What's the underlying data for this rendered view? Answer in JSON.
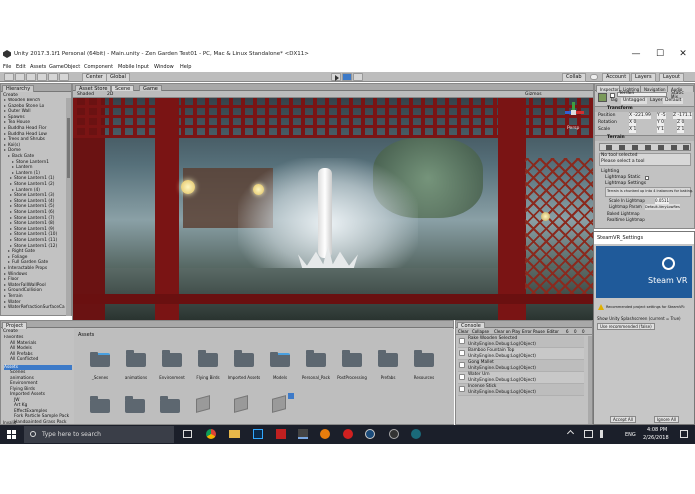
{
  "titlebar": {
    "title": "Unity 2017.3.1f1 Personal (64bit) - Main.unity - Zen Garden Test01 - PC, Mac & Linux Standalone* <DX11>",
    "minimize": "—",
    "maximize": "☐",
    "close": "✕"
  },
  "menubar": {
    "items": [
      "File",
      "Edit",
      "Assets",
      "GameObject",
      "Component",
      "Mobile Input",
      "Window",
      "Help"
    ]
  },
  "toolbar": {
    "center_mode": "Center",
    "global_mode": "Global",
    "collab": "Collab",
    "account": "Account",
    "layers": "Layers",
    "layout": "Layout"
  },
  "hierarchy": {
    "tab": "Hierarchy",
    "create": "Create",
    "items": [
      "Wooden Bench",
      "Gazebo Stone Lo",
      "Outer Wall",
      "Spawns",
      "Tea House",
      "Buddha Head Flor",
      "Buddha Head Low",
      "Trees and Shrubs",
      "Koi(s)",
      "Dome",
      "Back Gate",
      "Stone Lantern1",
      "Lantern",
      "Lantern (1)",
      "Stone Lantern1 (1)",
      "Stone Lantern1 (2)",
      "Lantern (4)",
      "Stone Lantern1 (3)",
      "Stone Lantern1 (4)",
      "Stone Lantern1 (5)",
      "Stone Lantern1 (6)",
      "Stone Lantern1 (7)",
      "Stone Lantern1 (8)",
      "Stone Lantern1 (9)",
      "Stone Lantern1 (10)",
      "Stone Lantern1 (11)",
      "Stone Lantern1 (12)",
      "Right Gate",
      "Foliage",
      "Full Garden Gate",
      "Interactable Props",
      "Windows",
      "Floor",
      "WaterFallWallPool",
      "GroundCollision",
      "Terrain",
      "Water",
      "WaterRefractionSurfaceCam"
    ]
  },
  "scene": {
    "tabs": [
      "Asset Store",
      "Scene",
      "Game"
    ],
    "shaded": "Shaded",
    "mode2d": "2D",
    "gizmos": "Gizmos",
    "persp": "Persp"
  },
  "project": {
    "tab": "Project",
    "create": "Create",
    "favorites": [
      "Favorites",
      "All Materials",
      "All Models",
      "All Prefabs",
      "All Conflicted"
    ],
    "tree": [
      "Assets",
      "Scenes",
      "animations",
      "Environment",
      "Flying Birds",
      "Imported Assets",
      "JW",
      "Art Kg",
      "EffectExamples",
      "Fork Particle Sample Pack",
      "Handpainted Grass Pack"
    ],
    "breadcrumb": "Assets",
    "assets_row1": [
      "_Scenes",
      "animations",
      "Environment",
      "Flying Birds",
      "Imported Assets",
      "Models",
      "Personal_Pack",
      "PostProcessing",
      "Prefabs",
      "Resources"
    ],
    "status": "Invalid",
    "file_label": "Jam.unity"
  },
  "console": {
    "tab": "Console",
    "buttons": [
      "Clear",
      "Collapse",
      "Clear on Play",
      "Error Pause",
      "Editor"
    ],
    "counts": [
      "6",
      "0",
      "0"
    ],
    "rows": [
      {
        "title": "Rake Wooden Selected",
        "sub": "UnityEngine.Debug:Log(Object)"
      },
      {
        "title": "Bamboo Fountain Top",
        "sub": "UnityEngine.Debug:Log(Object)"
      },
      {
        "title": "Gong Mallet",
        "sub": "UnityEngine.Debug:Log(Object)"
      },
      {
        "title": "Water Urn",
        "sub": "UnityEngine.Debug:Log(Object)"
      },
      {
        "title": "Incense Stick",
        "sub": "UnityEngine.Debug:Log(Object)"
      }
    ]
  },
  "inspector": {
    "tabs": [
      "Inspector",
      "Lighting",
      "Navigation",
      "Audio Mix"
    ],
    "object_name": "Terrain",
    "static": "Static",
    "tag_label": "Tag",
    "tag_value": "Untagged",
    "layer_label": "Layer",
    "layer_value": "Default",
    "transform": "Transform",
    "position": "Position",
    "rotation": "Rotation",
    "scale": "Scale",
    "pos_x": "X -221.99",
    "pos_y": "Y -5",
    "pos_z": "Z -171.1",
    "rot_x": "X 0",
    "rot_y": "Y 0",
    "rot_z": "Z 0",
    "scl_x": "X 1",
    "scl_y": "Y 1",
    "scl_z": "Z 1",
    "terrain": "Terrain",
    "no_tool": "No tool selected",
    "please_select": "Please select a tool",
    "lighting": "Lighting",
    "lightmap_static": "Lightmap Static",
    "lightmap_settings": "Lightmap Settings",
    "lightmap_note": "Terrain is chunked up into 4 instances for baking.",
    "scale_in_lightmap": "Scale In Lightmap",
    "scale_value": "0.0511",
    "lightmap_param": "Lightmap Param",
    "param_value": "Default-VeryLowRes",
    "baked_lightmap": "Baked Lightmap",
    "realtime_lightmap": "Realtime Lightmap"
  },
  "steamvr_popup": {
    "title": "SteamVR_Settings",
    "logo_text": "Steam VR",
    "recommended": "Recommended project settings for SteamVR:",
    "row1": "Show Unity Splashscreen (current = True)",
    "use_recommended": "Use recommended (false)",
    "accept_all": "Accept All",
    "ignore_all": "Ignore All"
  },
  "taskbar": {
    "search_placeholder": "Type here to search",
    "time": "4:08 PM",
    "date": "2/26/2018",
    "lang": "ENG"
  },
  "colors": {
    "unity_panel": "#c2c2c2",
    "taskbar": "#1b1f2a",
    "steam_blue": "#1f5a9a",
    "selection": "#3d7ac8"
  }
}
